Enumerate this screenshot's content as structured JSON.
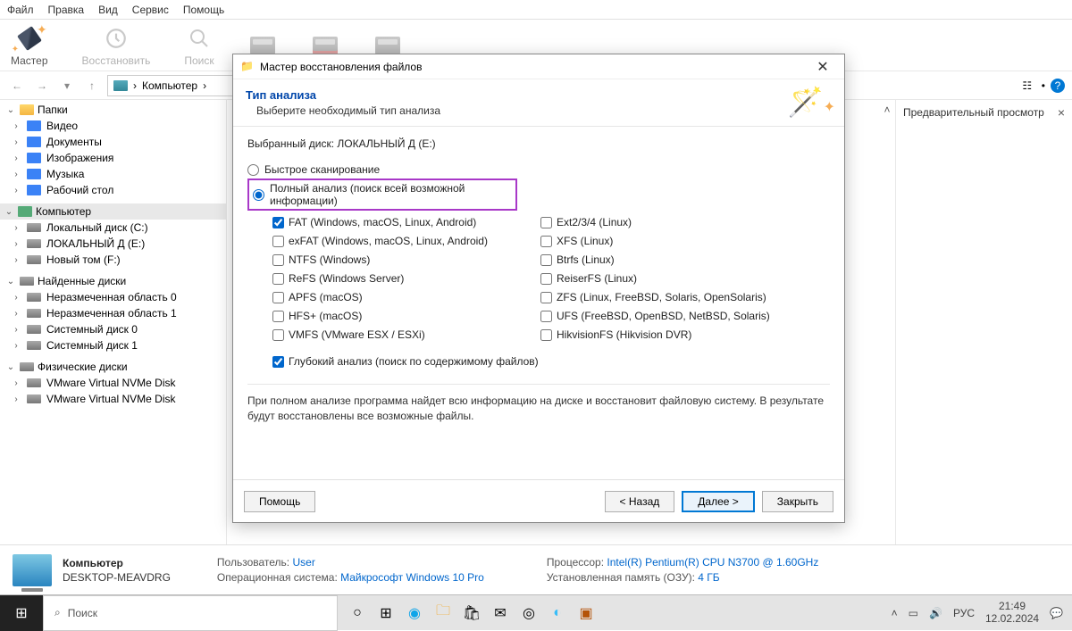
{
  "menu": {
    "items": [
      "Файл",
      "Правка",
      "Вид",
      "Сервис",
      "Помощь"
    ]
  },
  "toolbar": {
    "wizard": "Мастер",
    "restore": "Восстановить",
    "search": "Поиск"
  },
  "breadcrumb": {
    "root": "Компьютер",
    "sep": "›"
  },
  "sidebar": {
    "folders_hdr": "Папки",
    "folders": [
      "Видео",
      "Документы",
      "Изображения",
      "Музыка",
      "Рабочий стол"
    ],
    "computer_hdr": "Компьютер",
    "drives": [
      "Локальный диск (C:)",
      "ЛОКАЛЬНЫЙ Д (E:)",
      "Новый том (F:)"
    ],
    "found_hdr": "Найденные диски",
    "found": [
      "Неразмеченная область 0",
      "Неразмеченная область 1",
      "Системный диск 0",
      "Системный диск 1"
    ],
    "phys_hdr": "Физические диски",
    "phys": [
      "VMware Virtual NVMe Disk",
      "VMware Virtual NVMe Disk"
    ]
  },
  "preview": {
    "title": "Предварительный просмотр"
  },
  "status": {
    "title": "Компьютер",
    "host": "DESKTOP-MEAVDRG",
    "user_l": "Пользователь:",
    "user_v": "User",
    "os_l": "Операционная система:",
    "os_v": "Майкрософт Windows 10 Pro",
    "cpu_l": "Процессор:",
    "cpu_v": "Intel(R) Pentium(R) CPU  N3700  @ 1.60GHz",
    "ram_l": "Установленная память (ОЗУ):",
    "ram_v": "4 ГБ"
  },
  "dialog": {
    "title": "Мастер восстановления файлов",
    "heading": "Тип анализа",
    "sub": "Выберите необходимый тип анализа",
    "selected_l": "Выбранный диск:",
    "selected_v": "ЛОКАЛЬНЫЙ Д (E:)",
    "quick": "Быстрое сканирование",
    "full": "Полный анализ (поиск всей возможной информации)",
    "fs_left": [
      {
        "l": "FAT (Windows, macOS, Linux, Android)",
        "c": true
      },
      {
        "l": "exFAT (Windows, macOS, Linux, Android)",
        "c": false
      },
      {
        "l": "NTFS (Windows)",
        "c": false
      },
      {
        "l": "ReFS (Windows Server)",
        "c": false
      },
      {
        "l": "APFS (macOS)",
        "c": false
      },
      {
        "l": "HFS+ (macOS)",
        "c": false
      },
      {
        "l": "VMFS (VMware ESX / ESXi)",
        "c": false
      }
    ],
    "fs_right": [
      {
        "l": "Ext2/3/4 (Linux)",
        "c": false
      },
      {
        "l": "XFS (Linux)",
        "c": false
      },
      {
        "l": "Btrfs (Linux)",
        "c": false
      },
      {
        "l": "ReiserFS (Linux)",
        "c": false
      },
      {
        "l": "ZFS (Linux, FreeBSD, Solaris, OpenSolaris)",
        "c": false
      },
      {
        "l": "UFS (FreeBSD, OpenBSD, NetBSD, Solaris)",
        "c": false
      },
      {
        "l": "HikvisionFS (Hikvision DVR)",
        "c": false
      }
    ],
    "deep": "Глубокий анализ (поиск по содержимому файлов)",
    "note": "При полном анализе программа найдет всю информацию на диске и восстановит файловую систему. В результате будут восстановлены все возможные файлы.",
    "help": "Помощь",
    "back": "< Назад",
    "next": "Далее >",
    "close": "Закрыть"
  },
  "taskbar": {
    "search": "Поиск",
    "lang": "РУС",
    "time": "21:49",
    "date": "12.02.2024"
  }
}
